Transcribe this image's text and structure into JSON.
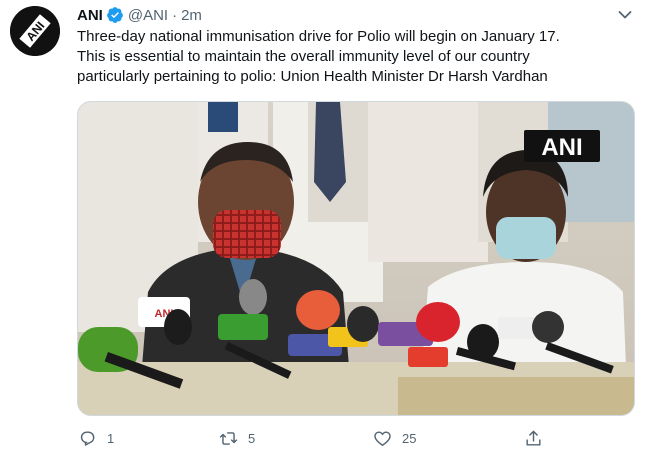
{
  "tweet": {
    "author_name": "ANI",
    "handle": "@ANI",
    "separator": "·",
    "time": "2m",
    "text_lines": [
      "Three-day national immunisation drive for Polio will begin on January 17.",
      "This is essential to maintain the overall immunity level of our country",
      "particularly pertaining to polio: Union Health Minister Dr Harsh Vardhan"
    ],
    "media": {
      "watermark": "ANI"
    },
    "actions": {
      "reply_count": "1",
      "retweet_count": "5",
      "like_count": "25"
    }
  },
  "icons": {
    "verified": "verified-badge-icon",
    "more": "chevron-down-icon",
    "reply": "reply-icon",
    "retweet": "retweet-icon",
    "like": "heart-icon",
    "share": "share-icon"
  },
  "colors": {
    "verified": "#1d9bf0",
    "secondary_text": "#536471",
    "text": "#0f1419"
  }
}
